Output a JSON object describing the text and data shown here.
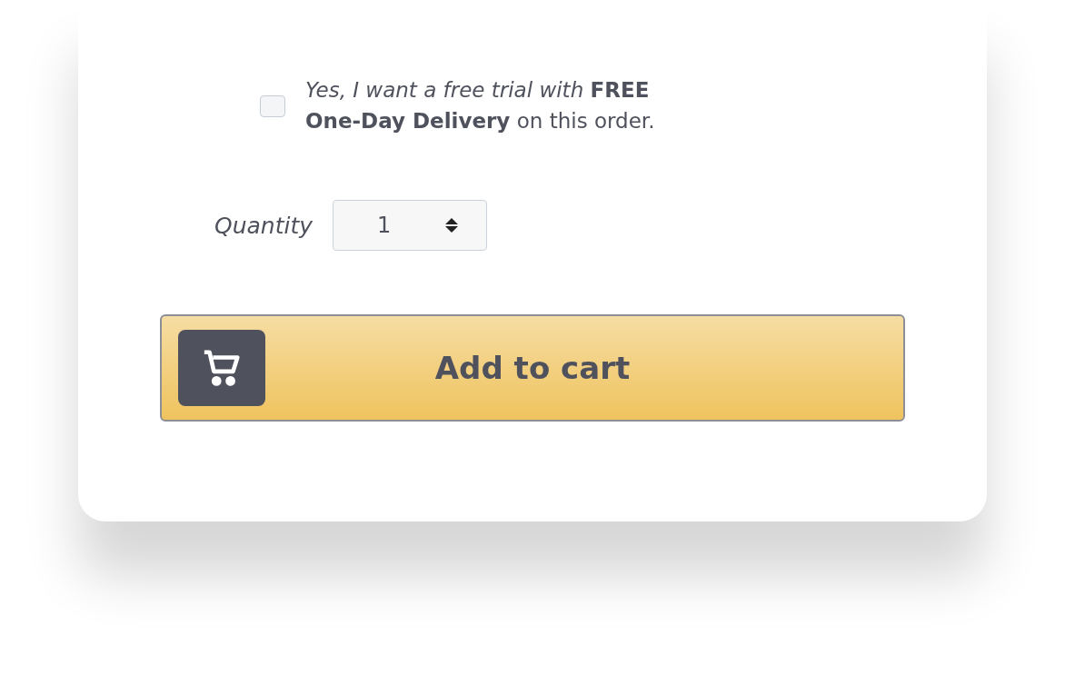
{
  "trial_offer": {
    "checked": false,
    "text": "*Yes, I want a free trial with* **FREE One-Day Delivery** on this order."
  },
  "quantity": {
    "label": "Quantity",
    "value": "1"
  },
  "add_to_cart": {
    "label": "Add to cart"
  }
}
